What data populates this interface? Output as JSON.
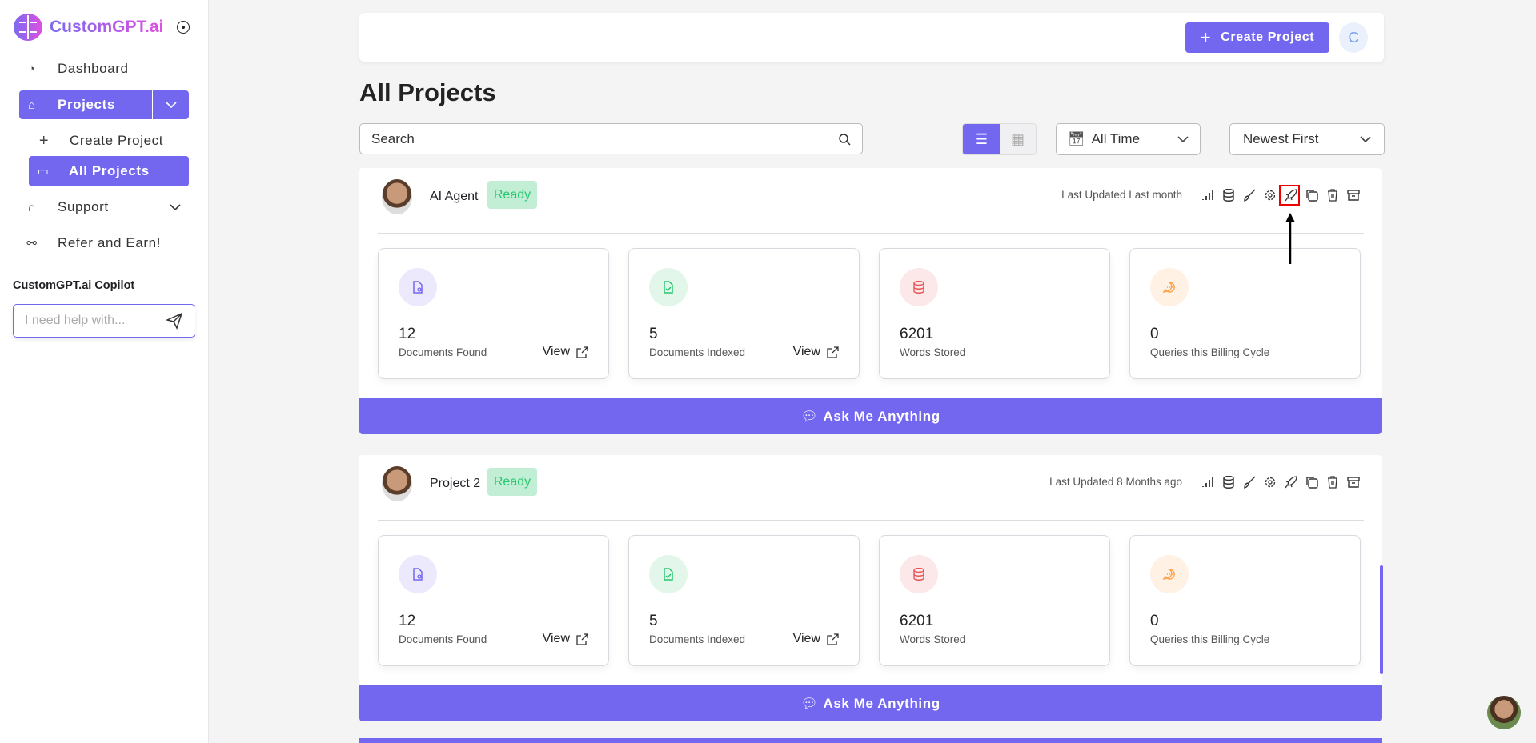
{
  "sidebar": {
    "brand": "CustomGPT.ai",
    "items": [
      {
        "label": "Dashboard",
        "icon": "gauge-icon"
      },
      {
        "label": "Projects",
        "icon": "home-icon"
      },
      {
        "label": "Create Project",
        "icon": "plus-icon"
      },
      {
        "label": "All Projects",
        "icon": "folder-icon"
      },
      {
        "label": "Support",
        "icon": "headphones-icon"
      },
      {
        "label": "Refer and Earn!",
        "icon": "share-icon"
      }
    ],
    "copilot_title": "CustomGPT.ai Copilot",
    "copilot_placeholder": "I need help with..."
  },
  "header": {
    "create_label": "Create Project",
    "avatar_letter": "C"
  },
  "page": {
    "title": "All Projects",
    "search_placeholder": "Search",
    "date_filter": "All Time",
    "sort": "Newest First"
  },
  "colors": {
    "accent": "#7367f0",
    "ready": "#28c76f"
  },
  "projects": [
    {
      "name": "AI Agent",
      "status": "Ready",
      "updated": "Last Updated Last month",
      "stats": [
        {
          "value": "12",
          "label": "Documents Found",
          "link": "View"
        },
        {
          "value": "5",
          "label": "Documents Indexed",
          "link": "View"
        },
        {
          "value": "6201",
          "label": "Words Stored"
        },
        {
          "value": "0",
          "label": "Queries this Billing Cycle"
        }
      ],
      "ask": "Ask Me Anything"
    },
    {
      "name": "Project 2",
      "status": "Ready",
      "updated": "Last Updated 8 Months ago",
      "stats": [
        {
          "value": "12",
          "label": "Documents Found",
          "link": "View"
        },
        {
          "value": "5",
          "label": "Documents Indexed",
          "link": "View"
        },
        {
          "value": "6201",
          "label": "Words Stored"
        },
        {
          "value": "0",
          "label": "Queries this Billing Cycle"
        }
      ],
      "ask": "Ask Me Anything"
    }
  ]
}
